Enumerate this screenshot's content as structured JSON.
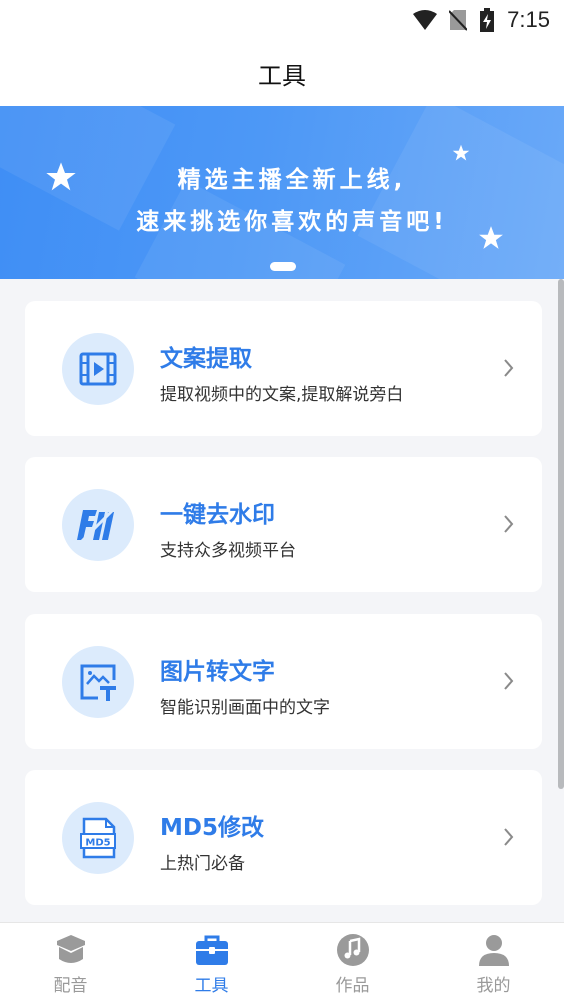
{
  "status_bar": {
    "time": "7:15"
  },
  "header": {
    "title": "工具"
  },
  "banner": {
    "line1": "精选主播全新上线,",
    "line2": "速来挑选你喜欢的声音吧!"
  },
  "tools": [
    {
      "title": "文案提取",
      "desc": "提取视频中的文案,提取解说旁白",
      "icon": "film-icon"
    },
    {
      "title": "一键去水印",
      "desc": "支持众多视频平台",
      "icon": "watermark-icon"
    },
    {
      "title": "图片转文字",
      "desc": "智能识别画面中的文字",
      "icon": "image-text-icon"
    },
    {
      "title": "MD5修改",
      "desc": "上热门必备",
      "icon": "md5-file-icon"
    }
  ],
  "tabbar": {
    "items": [
      {
        "label": "配音",
        "icon": "graduation-cap-icon",
        "active": false
      },
      {
        "label": "工具",
        "icon": "toolbox-icon",
        "active": true
      },
      {
        "label": "作品",
        "icon": "music-note-icon",
        "active": false
      },
      {
        "label": "我的",
        "icon": "person-icon",
        "active": false
      }
    ]
  },
  "colors": {
    "accent": "#2f7ce8",
    "icon_bg": "#dcebfc",
    "inactive": "#9a9a9a",
    "page_bg": "#f4f5f8"
  }
}
